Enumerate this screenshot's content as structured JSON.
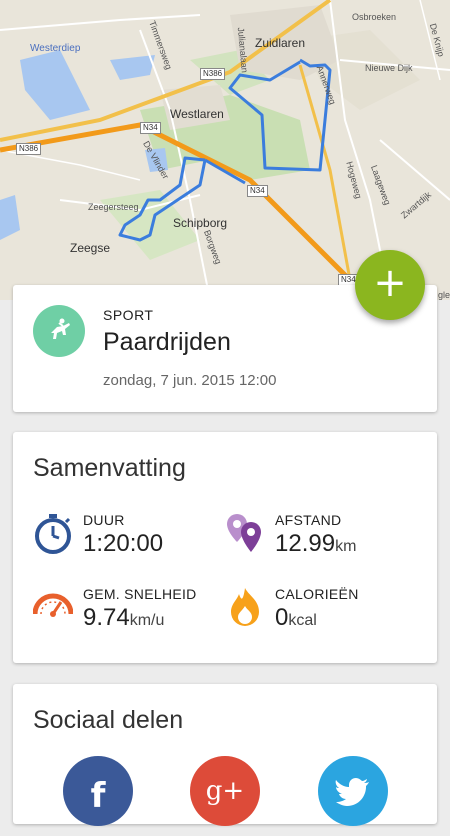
{
  "map": {
    "places": {
      "zuidlaren": "Zuidlaren",
      "westlaren": "Westlaren",
      "schipborg": "Schipborg",
      "zeegse": "Zeegse",
      "westerdiep": "Westerdiep",
      "oosterbroeken": "Osbroeken",
      "nieuwe_dijk": "Nieuwe Dijk",
      "annerweg": "Annerweg",
      "hogeweg": "Hogeweg",
      "laageweg": "Laageweg",
      "zwartdijk": "Zwartdijk",
      "de_vlinder": "De Vlinder",
      "zeegerstraat": "Zeegersteeg",
      "borgweg": "Borgweg",
      "timmersweg": "Timmersweg",
      "julianalaan": "Julianalaan",
      "de_knijp": "De Knijp"
    },
    "road_badges": {
      "n386_a": "N386",
      "n386_b": "N386",
      "n34_a": "N34",
      "n34_b": "N34",
      "n34_c": "N34"
    },
    "google_mark": "gle"
  },
  "fab": {
    "label": "+",
    "icon": "add-icon"
  },
  "sport": {
    "label": "SPORT",
    "name": "Paardrijden",
    "date": "zondag, 7 jun. 2015 12:00",
    "icon_color": "#6fcfa5"
  },
  "summary": {
    "title": "Samenvatting",
    "duration": {
      "label": "DUUR",
      "value": "1:20:00",
      "unit": ""
    },
    "distance": {
      "label": "AFSTAND",
      "value": "12.99",
      "unit": "km"
    },
    "speed": {
      "label": "GEM. SNELHEID",
      "value": "9.74",
      "unit": "km/u"
    },
    "calories": {
      "label": "CALORIEËN",
      "value": "0",
      "unit": "kcal"
    }
  },
  "social": {
    "title": "Sociaal delen",
    "facebook": {
      "label": "f",
      "color": "#3b5998"
    },
    "googleplus": {
      "label": "g+",
      "color": "#dd4b39"
    },
    "twitter": {
      "color": "#2ba5e0"
    }
  },
  "colors": {
    "accent": "#8bb61f",
    "route": "#3b7ddd",
    "stat_blue": "#2f5596",
    "stat_purple": "#7d3f98",
    "stat_orange": "#e8602c",
    "stat_fire": "#f7a11a"
  }
}
